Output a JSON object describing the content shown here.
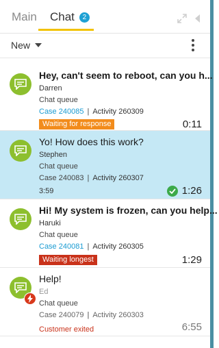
{
  "tabs": {
    "main_label": "Main",
    "chat_label": "Chat",
    "chat_count": "2"
  },
  "toolbar": {
    "new_label": "New"
  },
  "colors": {
    "accent_yellow": "#f2c200",
    "badge_blue": "#1ea1d4",
    "chat_green": "#8dbf2e",
    "selected_bg": "#c5e8f5",
    "waiting_orange": "#f28c1c",
    "alert_red": "#c9321a",
    "link_blue": "#1a9bd2"
  },
  "items": [
    {
      "title": "Hey, can't seem to reboot, can you h...",
      "person": "Darren",
      "queue": "Chat queue",
      "case": "Case 240085",
      "activity": "Activity 260309",
      "status": "Waiting for response",
      "timer": "0:11",
      "icon": "chat-bubble-icon"
    },
    {
      "title": "Yo! How does this work?",
      "person": "Stephen",
      "queue": "Chat queue",
      "case": "Case 240083",
      "activity": "Activity 260307",
      "elapsed": "3:59",
      "timer": "1:26",
      "icon": "chat-bubble-icon",
      "status_icon": "check-circle-icon"
    },
    {
      "title": "Hi! My system is frozen, can you help...",
      "person": "Haruki",
      "queue": "Chat queue",
      "case": "Case 240081",
      "activity": "Activity 260305",
      "status": "Waiting longest",
      "timer": "1:29",
      "icon": "chat-bubble-icon"
    },
    {
      "title": "Help!",
      "person": "Ed",
      "queue": "Chat queue",
      "case": "Case 240079",
      "activity": "Activity 260303",
      "status": "Customer exited",
      "timer": "6:55",
      "icon": "chat-bubble-icon",
      "overlay_icon": "lightning-icon"
    }
  ]
}
